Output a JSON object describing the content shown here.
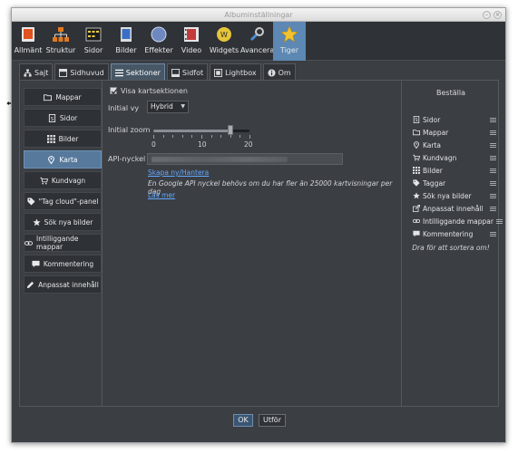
{
  "window": {
    "title": "Albuminställningar"
  },
  "toolbar": [
    {
      "label": "Allmänt",
      "icon": "general-icon"
    },
    {
      "label": "Struktur",
      "icon": "structure-icon"
    },
    {
      "label": "Sidor",
      "icon": "pages-icon"
    },
    {
      "label": "Bilder",
      "icon": "images-icon"
    },
    {
      "label": "Effekter",
      "icon": "effects-icon"
    },
    {
      "label": "Video",
      "icon": "video-icon"
    },
    {
      "label": "Widgets",
      "icon": "widgets-icon"
    },
    {
      "label": "Avancerat",
      "icon": "advanced-icon"
    },
    {
      "label": "Tiger",
      "icon": "tiger-icon",
      "selected": true
    }
  ],
  "tabs": [
    {
      "label": "Sajt",
      "icon": "sitemap-icon"
    },
    {
      "label": "Sidhuvud",
      "icon": "header-icon"
    },
    {
      "label": "Sektioner",
      "icon": "sections-icon",
      "selected": true
    },
    {
      "label": "Sidfot",
      "icon": "footer-icon"
    },
    {
      "label": "Lightbox",
      "icon": "lightbox-icon"
    },
    {
      "label": "Om",
      "icon": "info-icon"
    }
  ],
  "nav": [
    {
      "label": "Mappar",
      "icon": "folder-icon"
    },
    {
      "label": "Sidor",
      "icon": "page-icon"
    },
    {
      "label": "Bilder",
      "icon": "grid-icon"
    },
    {
      "label": "Karta",
      "icon": "map-marker-icon",
      "selected": true
    },
    {
      "label": "Kundvagn",
      "icon": "cart-icon"
    },
    {
      "label": "\"Tag cloud\"-panel",
      "icon": "tag-icon"
    },
    {
      "label": "Sök nya bilder",
      "icon": "star-icon"
    },
    {
      "label": "Intilliggande mappar",
      "icon": "link-icon"
    },
    {
      "label": "Kommentering",
      "icon": "comment-icon"
    },
    {
      "label": "Anpassat innehåll",
      "icon": "pencil-icon"
    }
  ],
  "form": {
    "show_map_label": "Visa kartsektionen",
    "show_map_checked": true,
    "initial_view_label": "Initial vy",
    "initial_view_value": "Hybrid",
    "initial_zoom_label": "Initial zoom",
    "zoom": {
      "value": 16,
      "min": 0,
      "max": 20,
      "ticks": [
        "0",
        "10",
        "20"
      ]
    },
    "api_key_label": "API-nyckel",
    "api_key_value": "",
    "create_link": "Skapa ny/Hantera",
    "note": "En Google API nyckel behövs om du har fler än 25000 kartvisningar per dag",
    "read_more_link": "Läs mer"
  },
  "order_panel": {
    "title": "Beställa",
    "items": [
      {
        "label": "Sidor",
        "icon": "page-icon"
      },
      {
        "label": "Mappar",
        "icon": "folder-icon"
      },
      {
        "label": "Karta",
        "icon": "map-marker-icon"
      },
      {
        "label": "Kundvagn",
        "icon": "cart-icon"
      },
      {
        "label": "Bilder",
        "icon": "grid-icon"
      },
      {
        "label": "Taggar",
        "icon": "tag-icon"
      },
      {
        "label": "Sök nya bilder",
        "icon": "star-icon"
      },
      {
        "label": "Anpassat innehåll",
        "icon": "external-edit-icon"
      },
      {
        "label": "Intilliggande mappar",
        "icon": "link-icon"
      },
      {
        "label": "Kommentering",
        "icon": "comment-icon"
      }
    ],
    "hint": "Dra för att sortera om!"
  },
  "buttons": {
    "ok": "OK",
    "apply": "Utför"
  },
  "colors": {
    "background": "#3b3e43",
    "selected": "#56799c",
    "link": "#63a9ff"
  }
}
